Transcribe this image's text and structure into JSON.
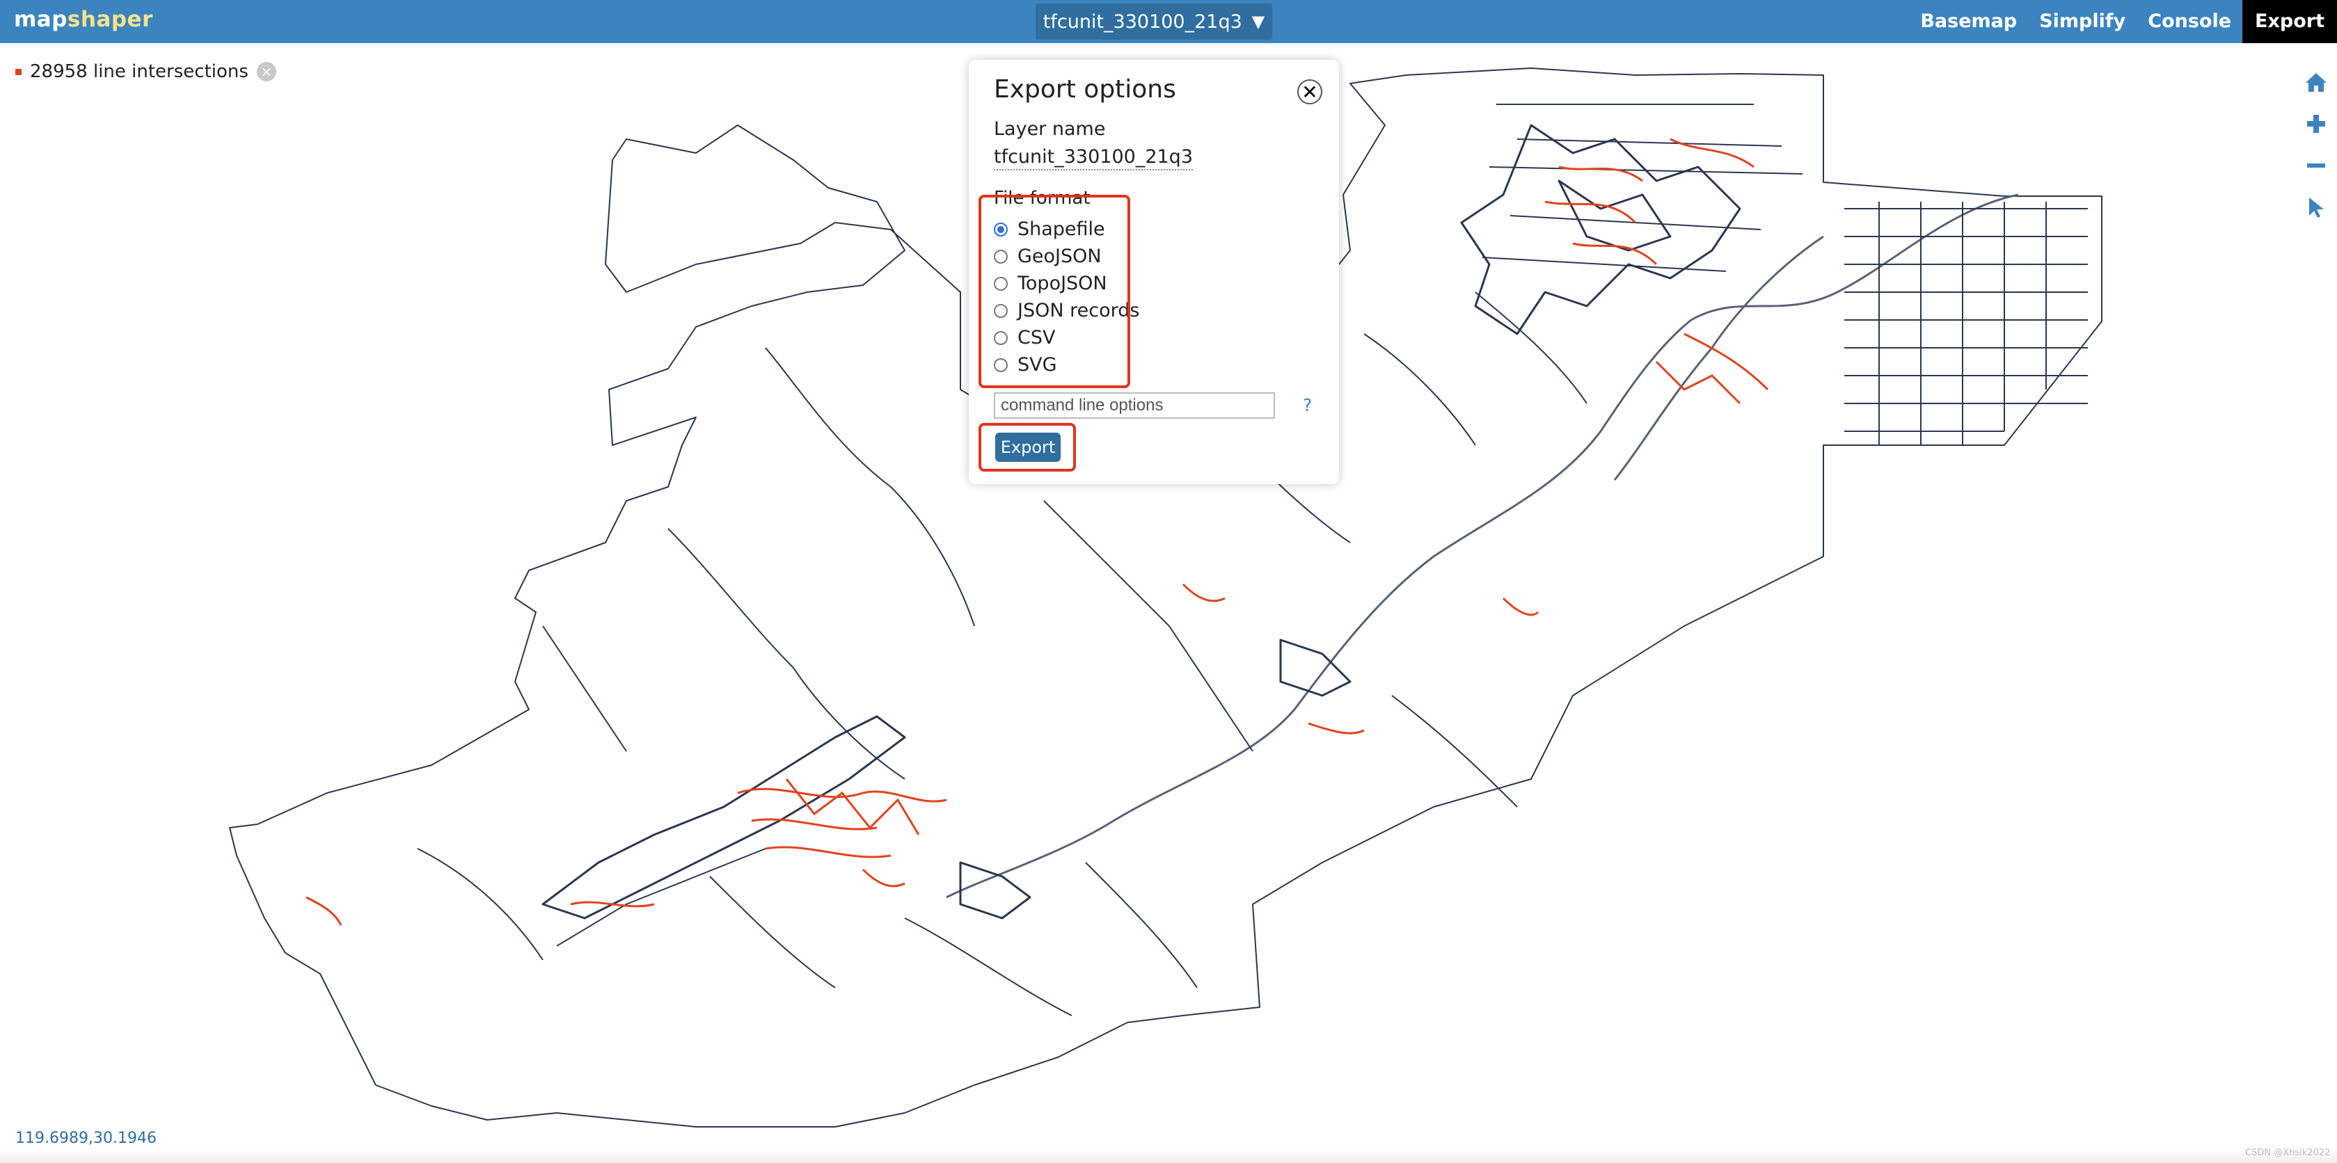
{
  "topbar": {
    "logo_part1": "map",
    "logo_part2": "shaper",
    "layer_name": "tfcunit_330100_21q3",
    "caret": "▼",
    "menu": {
      "basemap": "Basemap",
      "simplify": "Simplify",
      "console": "Console",
      "export": "Export"
    }
  },
  "intersections": {
    "text": "28958 line intersections",
    "clear_icon": "×"
  },
  "tools": {
    "home": "home-icon",
    "zoom_in": "plus-icon",
    "zoom_out": "minus-icon",
    "select": "pointer-icon"
  },
  "dialog": {
    "title": "Export options",
    "close": "✕",
    "layer_name_label": "Layer name",
    "layer_name": "tfcunit_330100_21q3",
    "file_format_label": "File format",
    "formats": [
      {
        "label": "Shapefile",
        "selected": true
      },
      {
        "label": "GeoJSON",
        "selected": false
      },
      {
        "label": "TopoJSON",
        "selected": false
      },
      {
        "label": "JSON records",
        "selected": false
      },
      {
        "label": "CSV",
        "selected": false
      },
      {
        "label": "SVG",
        "selected": false
      }
    ],
    "command_placeholder": "command line options",
    "command_value": "",
    "help": "?",
    "export_label": "Export"
  },
  "footer": {
    "coords": "119.6989,30.1946",
    "watermark": "CSDN @Xhsik2022"
  },
  "colors": {
    "topbar": "#3c84c0",
    "button": "#2f6e9f",
    "intersection": "#e0441c",
    "map_lines": "#2c3650",
    "highlight": "#e3331c",
    "logo_accent": "#f6e38a"
  }
}
